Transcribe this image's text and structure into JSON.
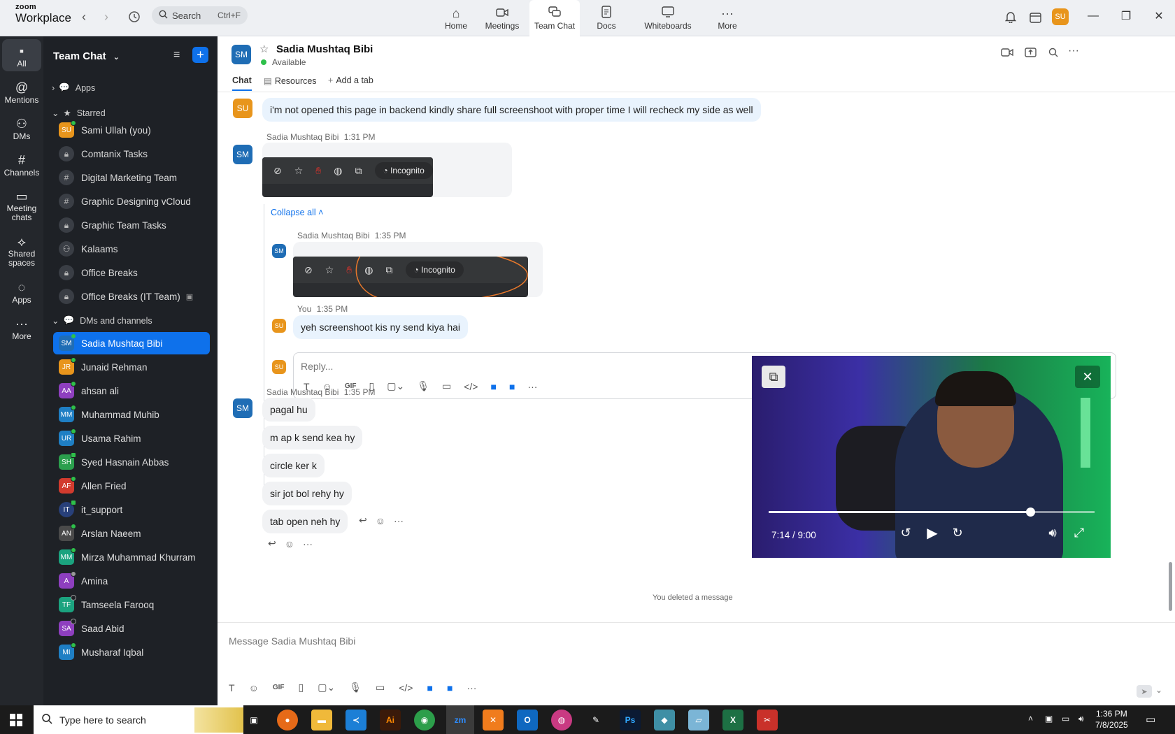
{
  "app": {
    "brand_small": "zoom",
    "brand_big": "Workplace"
  },
  "search": {
    "label": "Search",
    "shortcut": "Ctrl+F"
  },
  "nav_tabs": [
    {
      "label": "Home",
      "icon": "home-icon"
    },
    {
      "label": "Meetings",
      "icon": "video-camera-icon"
    },
    {
      "label": "Team Chat",
      "icon": "chat-bubbles-icon"
    },
    {
      "label": "Docs",
      "icon": "document-icon"
    },
    {
      "label": "Whiteboards",
      "icon": "whiteboard-icon"
    },
    {
      "label": "More",
      "icon": "more-dots-icon"
    }
  ],
  "user_avatar": "SU",
  "rail": [
    {
      "label": "All"
    },
    {
      "label": "Mentions"
    },
    {
      "label": "DMs"
    },
    {
      "label": "Channels"
    },
    {
      "label": "Meeting chats"
    },
    {
      "label": "Shared spaces"
    },
    {
      "label": "Apps"
    },
    {
      "label": "More"
    }
  ],
  "sidebar": {
    "title": "Team Chat",
    "apps_label": "Apps",
    "starred_label": "Starred",
    "dms_label": "DMs and channels",
    "starred": [
      {
        "label": "Sami Ullah (you)",
        "avatar": "SU",
        "color": "#e8951c",
        "kind": "dm"
      },
      {
        "label": "Comtanix Tasks",
        "kind": "locked"
      },
      {
        "label": "Digital Marketing Team",
        "kind": "hash"
      },
      {
        "label": "Graphic Designing vCloud",
        "kind": "hash"
      },
      {
        "label": "Graphic Team Tasks",
        "kind": "locked"
      },
      {
        "label": "Kalaams",
        "kind": "group"
      },
      {
        "label": "Office Breaks",
        "kind": "locked"
      },
      {
        "label": "Office Breaks (IT Team)",
        "kind": "locked"
      }
    ],
    "dms": [
      {
        "label": "Sadia Mushtaq Bibi",
        "avatar": "SM",
        "color": "#1f6db5",
        "selected": true
      },
      {
        "label": "Junaid Rehman",
        "avatar": "JR",
        "color": "#e8951c"
      },
      {
        "label": "ahsan ali",
        "avatar": "AA",
        "color": "#8e3fbf"
      },
      {
        "label": "Muhammad Muhib",
        "avatar": "MM",
        "color": "#1f7fc4"
      },
      {
        "label": "Usama Rahim",
        "avatar": "UR",
        "color": "#1f7fc4"
      },
      {
        "label": "Syed Hasnain Abbas",
        "avatar": "SH",
        "color": "#2b9f4d"
      },
      {
        "label": "Allen Fried",
        "avatar": "AF",
        "color": "#d23b2e"
      },
      {
        "label": "it_support",
        "avatar": "IT",
        "color": "#28407a"
      },
      {
        "label": "Arslan Naeem",
        "avatar": "AN",
        "color": "#4a4a4a"
      },
      {
        "label": "Mirza Muhammad Khurram",
        "avatar": "MM",
        "color": "#1ba37f"
      },
      {
        "label": "Amina",
        "avatar": "A",
        "color": "#8e3fbf"
      },
      {
        "label": "Tamseela Farooq",
        "avatar": "TF",
        "color": "#1ba37f"
      },
      {
        "label": "Saad Abid",
        "avatar": "SA",
        "color": "#8e3fbf"
      },
      {
        "label": "Musharaf Iqbal",
        "avatar": "MI",
        "color": "#1f7fc4"
      }
    ]
  },
  "chat": {
    "name": "Sadia Mushtaq Bibi",
    "avatar": "SM",
    "status": "Available",
    "tabs": [
      "Chat",
      "Resources",
      "Add a tab"
    ]
  },
  "messages": {
    "m1_text": "i'm not opened this page in backend kindly share full screenshoot with proper time I will recheck my side as well",
    "m1_avatar": "SU",
    "m2_sender": "Sadia Mushtaq Bibi",
    "m2_time": "1:31 PM",
    "incognito": "Incognito",
    "collapse_all": "Collapse all",
    "m3_sender": "Sadia Mushtaq Bibi",
    "m3_time": "1:35 PM",
    "m4_sender": "You",
    "m4_time": "1:35 PM",
    "m4_text": "yeh screenshoot kis ny send kiya hai",
    "reply_placeholder": "Reply...",
    "m5_sender": "Sadia Mushtaq Bibi",
    "m5_time": "1:35 PM",
    "m5_lines": [
      "pagal hu",
      "m ap k send kea hy",
      "circle ker k",
      "sir jot bol rehy hy",
      "tab open neh hy"
    ],
    "deleted_note": "You deleted a message"
  },
  "video": {
    "current": "7:14",
    "total": "9:00",
    "time_display": "7:14 / 9:00",
    "progress": 0.803
  },
  "composer": {
    "placeholder": "Message Sadia Mushtaq Bibi"
  },
  "taskbar": {
    "search_placeholder": "Type here to search",
    "time": "1:36 PM",
    "date": "7/8/2025"
  }
}
